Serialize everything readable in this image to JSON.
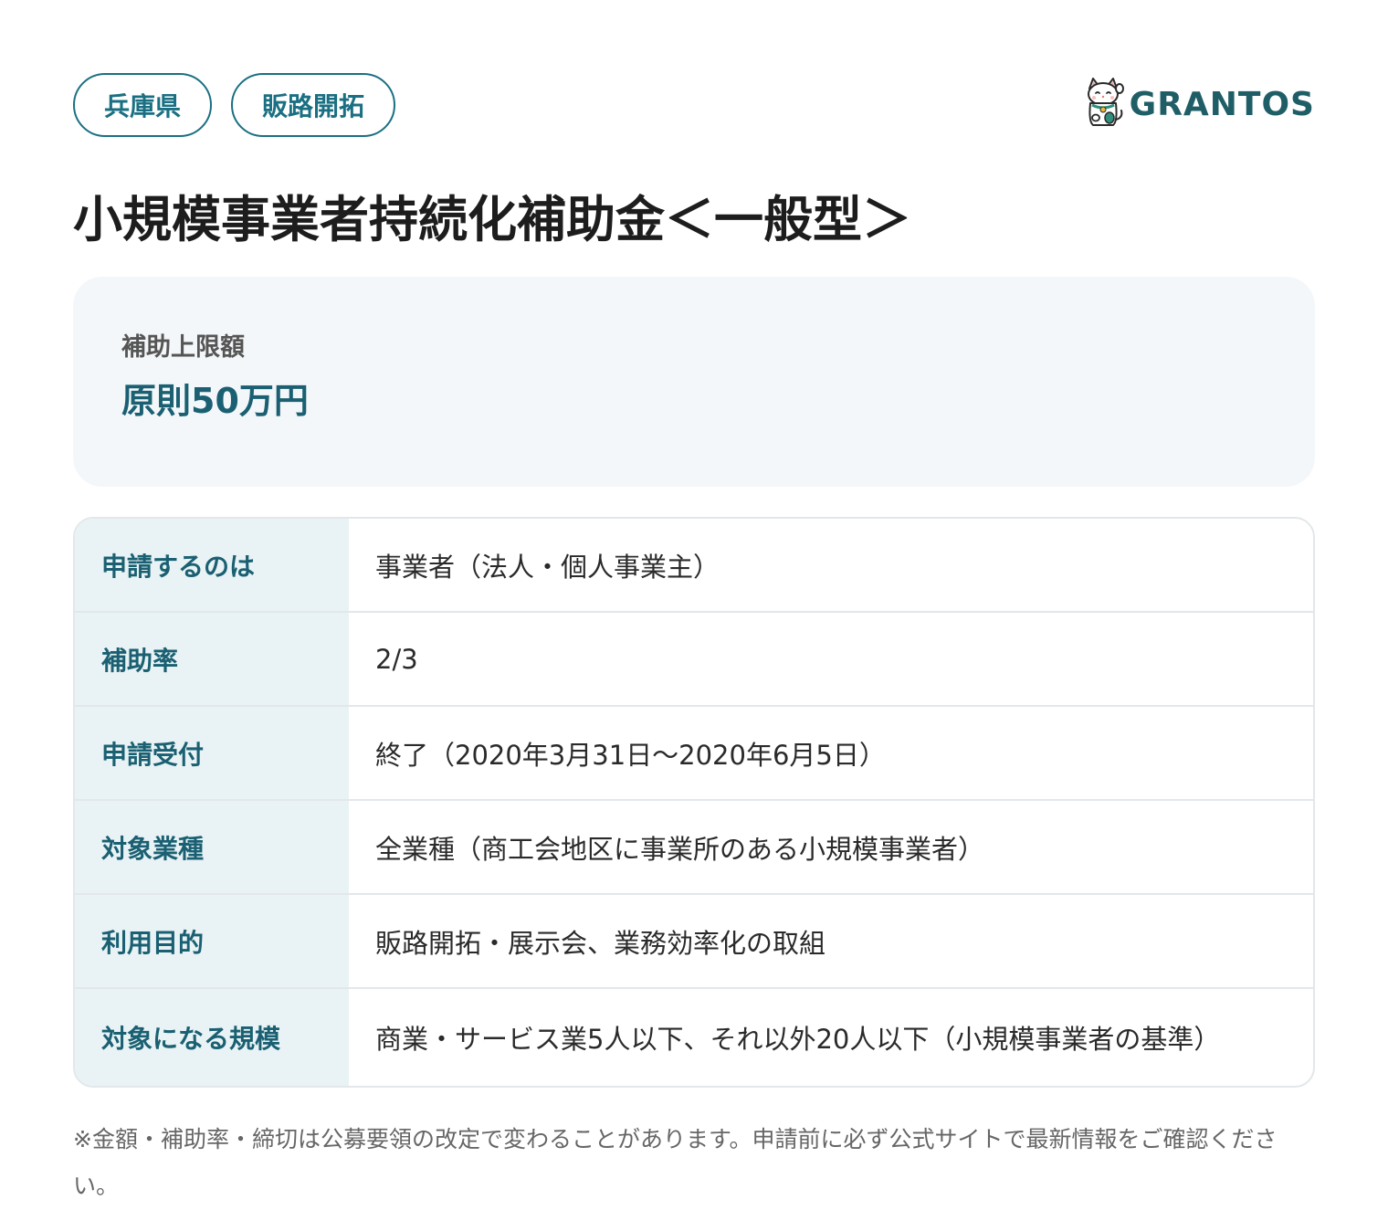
{
  "tags": [
    "兵庫県",
    "販路開拓"
  ],
  "logo": {
    "text": "GRANTOS",
    "icon": "maneki-neko-cat-icon",
    "color": "#1f5e66"
  },
  "title": "小規模事業者持続化補助金＜一般型＞",
  "limit": {
    "label": "補助上限額",
    "value": "原則50万円"
  },
  "rows": [
    {
      "key": "申請するのは",
      "value": "事業者（法人・個人事業主）"
    },
    {
      "key": "補助率",
      "value": "2/3"
    },
    {
      "key": "申請受付",
      "value": "終了（2020年3月31日〜2020年6月5日）"
    },
    {
      "key": "対象業種",
      "value": "全業種（商工会地区に事業所のある小規模事業者）"
    },
    {
      "key": "利用目的",
      "value": "販路開拓・展示会、業務効率化の取組"
    },
    {
      "key": "対象になる規模",
      "value": "商業・サービス業5人以下、それ以外20人以下（小規模事業者の基準）"
    }
  ],
  "footnote": "※金額・補助率・締切は公募要領の改定で変わることがあります。申請前に必ず公式サイトで最新情報をご確認ください。",
  "colors": {
    "accent": "#1a6f82",
    "key_background": "#e9f3f5",
    "card_background": "#f4f7f9"
  }
}
